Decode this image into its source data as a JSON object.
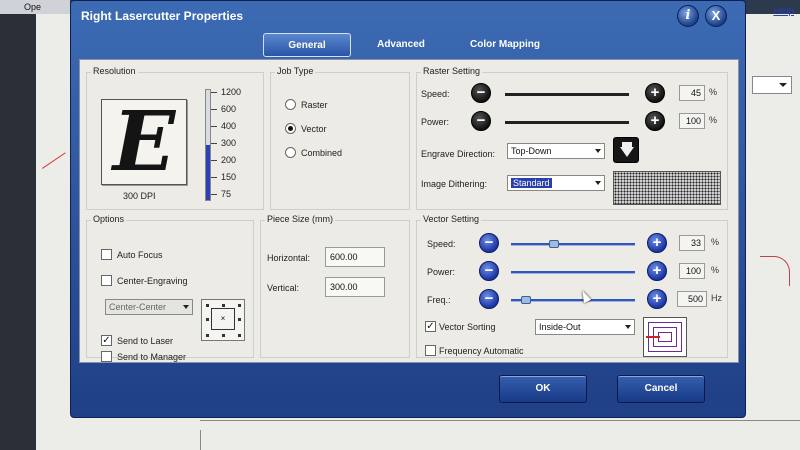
{
  "background": {
    "open_label": "Ope",
    "help_link": "Help"
  },
  "dialog": {
    "title": "Right Lasercutter Properties",
    "help_glyph": "i",
    "close_glyph": "X"
  },
  "tabs": [
    {
      "label": "General",
      "active": true
    },
    {
      "label": "Advanced",
      "active": false
    },
    {
      "label": "Color Mapping",
      "active": false
    }
  ],
  "resolution": {
    "group_label": "Resolution",
    "preview_letter": "E",
    "dpi_label": "300 DPI",
    "ticks": [
      "1200",
      "600",
      "400",
      "300",
      "200",
      "150",
      "75"
    ],
    "selected_fraction": 0.5
  },
  "job_type": {
    "group_label": "Job Type",
    "options": [
      {
        "label": "Raster",
        "selected": false
      },
      {
        "label": "Vector",
        "selected": true
      },
      {
        "label": "Combined",
        "selected": false
      }
    ]
  },
  "raster_setting": {
    "group_label": "Raster Setting",
    "speed_label": "Speed:",
    "speed_value": "45",
    "power_label": "Power:",
    "power_value": "100",
    "percent": "%",
    "engrave_direction_label": "Engrave Direction:",
    "engrave_direction_value": "Top-Down",
    "image_dithering_label": "Image Dithering:",
    "image_dithering_value": "Standard"
  },
  "options": {
    "group_label": "Options",
    "auto_focus": {
      "label": "Auto Focus",
      "checked": false
    },
    "center_engraving": {
      "label": "Center-Engraving",
      "checked": false
    },
    "center_mode": "Center-Center",
    "send_to_laser": {
      "label": "Send to Laser",
      "checked": true
    },
    "send_to_manager": {
      "label": "Send to Manager",
      "checked": false
    }
  },
  "piece_size": {
    "group_label": "Piece Size (mm)",
    "horizontal_label": "Horizontal:",
    "horizontal_value": "600.00",
    "vertical_label": "Vertical:",
    "vertical_value": "300.00"
  },
  "vector_setting": {
    "group_label": "Vector Setting",
    "speed_label": "Speed:",
    "speed_value": "33",
    "power_label": "Power:",
    "power_value": "100",
    "freq_label": "Freq.:",
    "freq_value": "500",
    "percent": "%",
    "hz": "Hz",
    "vector_sorting": {
      "label": "Vector Sorting",
      "checked": true
    },
    "sorting_value": "Inside-Out",
    "frequency_automatic": {
      "label": "Frequency Automatic",
      "checked": false
    }
  },
  "footer": {
    "ok_label": "OK",
    "cancel_label": "Cancel"
  },
  "colors": {
    "title_blue": "#2a55a5",
    "slider_blue": "#2c3fb7",
    "panel": "#ecebe6"
  }
}
